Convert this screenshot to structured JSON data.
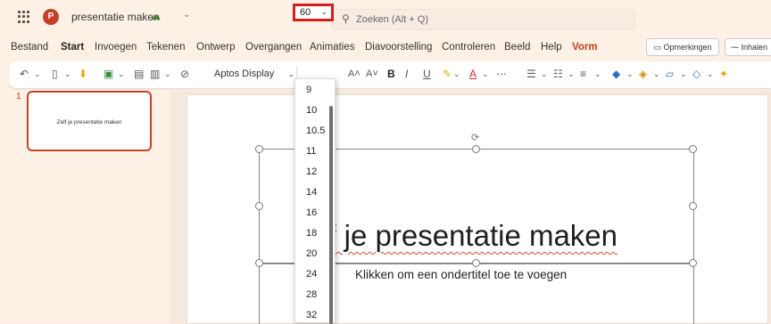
{
  "titlebar": {
    "doc_title": "presentatie maken",
    "search_placeholder": "Zoeken (Alt + Q)"
  },
  "menu": [
    "Bestand",
    "Start",
    "Invoegen",
    "Tekenen",
    "Ontwerp",
    "Overgangen",
    "Animaties",
    "Diavoorstelling",
    "Controleren",
    "Beeld",
    "Help",
    "Vorm"
  ],
  "menu_active": "Start",
  "buttons": {
    "comments": "Opmerkingen",
    "catchup": "Inhalen"
  },
  "ribbon": {
    "font_name": "Aptos Display",
    "font_size": "60"
  },
  "font_sizes": [
    "9",
    "10",
    "10.5",
    "11",
    "12",
    "14",
    "16",
    "18",
    "20",
    "24",
    "28",
    "32"
  ],
  "slides_panel": {
    "slide_number": "1",
    "thumb_text": "Zelf je presentatie maken"
  },
  "slide": {
    "title": "lf je presentatie maken",
    "subtitle": "Klikken om een ondertitel toe te voegen"
  },
  "colors": {
    "accent": "#c43e1c",
    "highlight": "#d22020"
  }
}
